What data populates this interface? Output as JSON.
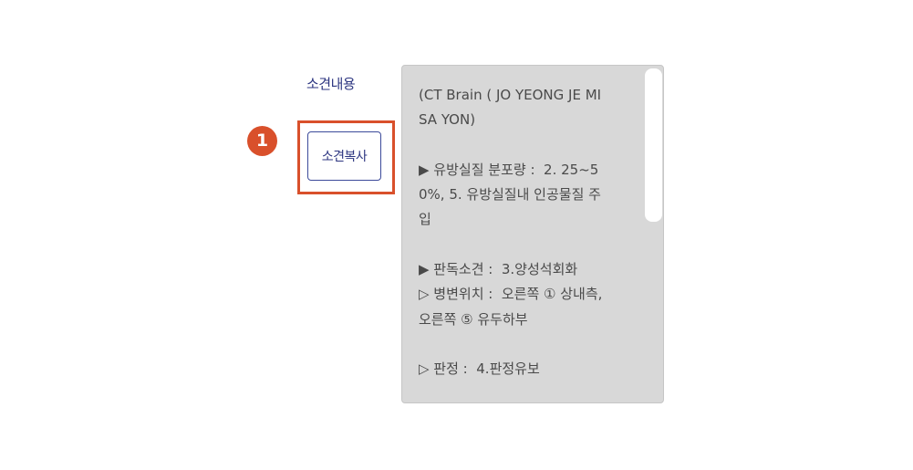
{
  "form": {
    "label": "소견내용",
    "copy_button_label": "소견복사",
    "step_number": "1"
  },
  "report": {
    "lines": [
      "(CT Brain ( JO YEONG JE MI",
      "SA YON)",
      "",
      "▶ 유방실질 분포량 :  2. 25~5",
      "0%, 5. 유방실질내 인공물질 주",
      "입",
      "",
      "▶ 판독소견 :  3.양성석회화",
      "▷ 병변위치 :  오른쪽 ① 상내측,",
      "오른쪽 ⑤ 유두하부",
      "",
      "▷ 판정 :  4.판정유보"
    ]
  },
  "colors": {
    "accent": "#d9502b",
    "label": "#2c3580",
    "report_bg": "#d8d8d8"
  }
}
